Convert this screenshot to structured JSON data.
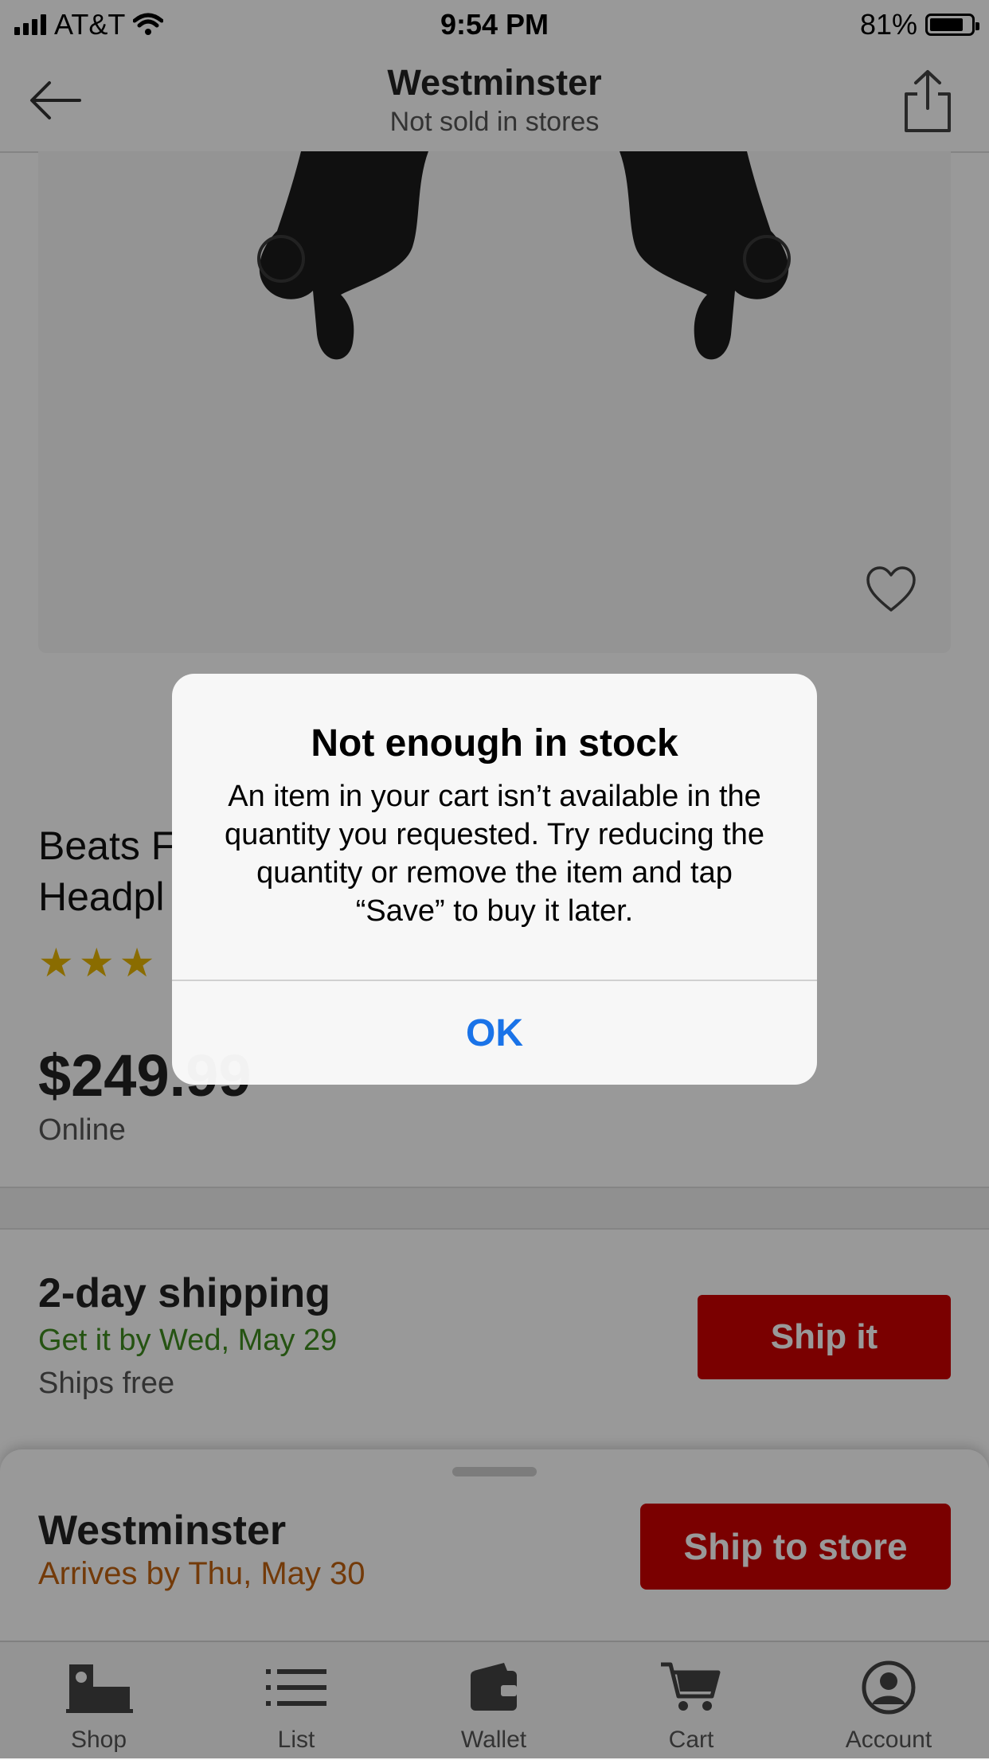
{
  "status_bar": {
    "carrier": "AT&T",
    "time": "9:54 PM",
    "battery_percent": "81%",
    "battery_level": 0.81
  },
  "header": {
    "title": "Westminster",
    "subtitle": "Not sold in stores",
    "back_icon": "back-arrow-icon",
    "share_icon": "share-icon"
  },
  "product": {
    "title": "Beats F\nHeadpl",
    "rating_stars_visible": 3,
    "price": "$249.99",
    "price_channel": "Online",
    "favorite_icon": "heart-icon"
  },
  "shipping": {
    "title": "2-day shipping",
    "date": "Get it by Wed, May 29",
    "cost": "Ships free",
    "button_label": "Ship it"
  },
  "store_sheet": {
    "store": "Westminster",
    "arrival": "Arrives by Thu, May 30",
    "button_label": "Ship to store"
  },
  "tabs": [
    {
      "label": "Shop",
      "icon": "store-icon"
    },
    {
      "label": "List",
      "icon": "list-icon"
    },
    {
      "label": "Wallet",
      "icon": "wallet-icon"
    },
    {
      "label": "Cart",
      "icon": "cart-icon"
    },
    {
      "label": "Account",
      "icon": "account-icon"
    }
  ],
  "alert": {
    "title": "Not enough in stock",
    "message": "An item in your cart isn’t available in the quantity you requested. Try reducing the quantity or remove the item and tap “Save” to buy it later.",
    "ok_label": "OK"
  },
  "colors": {
    "primary_red": "#cc0000",
    "link_blue": "#1a73e8",
    "ship_green": "#3e8a1f",
    "arrival_orange": "#c0620f"
  }
}
